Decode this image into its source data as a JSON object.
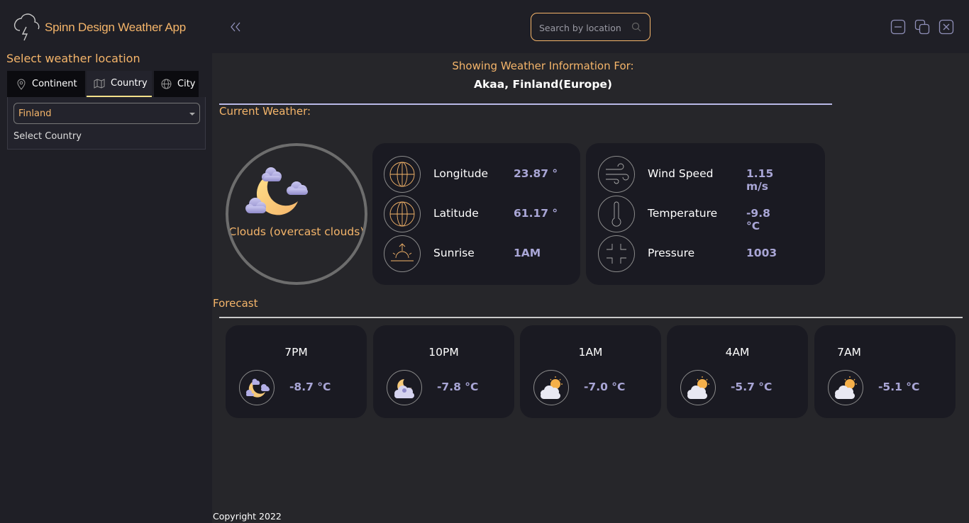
{
  "app": {
    "title": "Spinn Design Weather App",
    "logo_icon": "cloud-lightning-icon"
  },
  "search": {
    "placeholder": "Search by location"
  },
  "sidebar": {
    "title": "Select weather location",
    "tabs": [
      {
        "label": "Continent",
        "icon": "map-pin-icon"
      },
      {
        "label": "Country",
        "icon": "map-icon",
        "active": true
      },
      {
        "label": "City",
        "icon": "globe-icon"
      }
    ],
    "country_value": "Finland",
    "select_label": "Select Country"
  },
  "header": {
    "showing_label": "Showing Weather Information For:",
    "location": "Akaa, Finland(Europe)"
  },
  "current": {
    "section_label": "Current Weather:",
    "description": "Clouds (overcast clouds)",
    "details_left": [
      {
        "label": "Longitude",
        "value": "23.87 °",
        "icon": "globe-icon"
      },
      {
        "label": "Latitude",
        "value": "61.17 °",
        "icon": "globe-icon"
      },
      {
        "label": "Sunrise",
        "value": "1AM",
        "icon": "sunrise-icon"
      }
    ],
    "details_right": [
      {
        "label": "Wind Speed",
        "value": "1.15 m/s",
        "icon": "wind-icon"
      },
      {
        "label": "Temperature",
        "value": "-9.8 °C",
        "icon": "thermometer-icon"
      },
      {
        "label": "Pressure",
        "value": "1003",
        "icon": "pressure-icon"
      }
    ]
  },
  "forecast": {
    "section_label": "Forecast",
    "items": [
      {
        "time": "7PM",
        "temp": "-8.7 °C",
        "icon": "moon-clouds-icon"
      },
      {
        "time": "10PM",
        "temp": "-7.8 °C",
        "icon": "cloud-moon-icon"
      },
      {
        "time": "1AM",
        "temp": "-7.0 °C",
        "icon": "sun-cloud-icon"
      },
      {
        "time": "4AM",
        "temp": "-5.7 °C",
        "icon": "sun-cloud-icon"
      },
      {
        "time": "7AM",
        "temp": "-5.1 °C",
        "icon": "sun-cloud-icon"
      }
    ]
  },
  "footer": {
    "copyright": "Copyright 2022"
  },
  "colors": {
    "accent": "#f5b56a",
    "value": "#a9a6d6",
    "card_bg": "#1a1a22",
    "main_bg": "#26262a",
    "sidebar_bg": "#1f1f26"
  }
}
